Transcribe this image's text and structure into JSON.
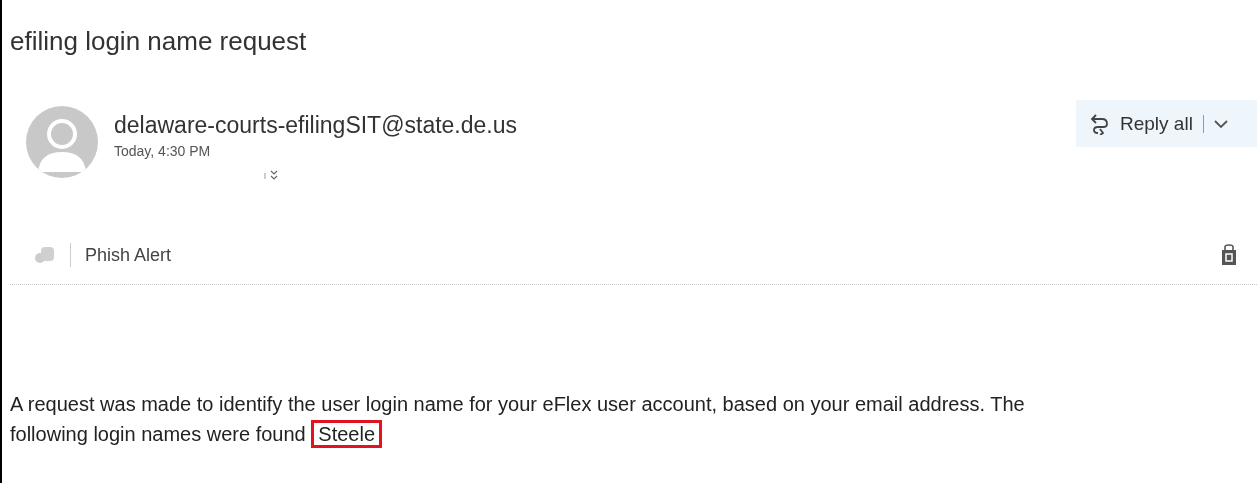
{
  "message": {
    "subject": "efiling login name request",
    "sender": "delaware-courts-efilingSIT@state.de.us",
    "time": "Today, 4:30 PM"
  },
  "toolbar": {
    "reply_label": "Reply all"
  },
  "addin_bar": {
    "label": "Phish Alert"
  },
  "body": {
    "text": "A request was made to identify the user login name for your eFlex user account, based on your email address. The following login names were found",
    "highlighted_name": "Steele"
  }
}
